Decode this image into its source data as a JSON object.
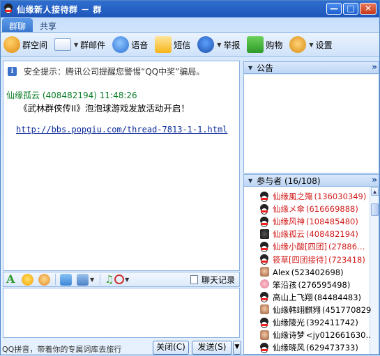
{
  "window": {
    "title": "仙缘新人接待群 － 群"
  },
  "tabs": [
    {
      "label": "群聊"
    },
    {
      "label": "共享"
    }
  ],
  "toolbar": {
    "items": [
      {
        "label": "群空间",
        "icon": "group-space-icon"
      },
      {
        "label": "群邮件",
        "icon": "mail-icon"
      },
      {
        "label": "语音",
        "icon": "voice-icon"
      },
      {
        "label": "短信",
        "icon": "sms-icon"
      },
      {
        "label": "举报",
        "icon": "report-icon"
      },
      {
        "label": "购物",
        "icon": "shopping-icon"
      },
      {
        "label": "设置",
        "icon": "settings-icon"
      }
    ]
  },
  "chat": {
    "notice": "安全提示：腾讯公司提醒您警惕“QQ中奖”骗局。",
    "message": {
      "sender": "仙缘孤云",
      "sender_id": "(408482194)",
      "time": "11:48:26",
      "text": "《武林群侠传II》泡泡球游戏发放活动开启！",
      "link": "http://bbs.popgiu.com/thread-7813-1-1.html"
    }
  },
  "format_bar": {
    "history_label": "聊天记录"
  },
  "bottom": {
    "ime_tip": "QQ拼音，带着你的专属词库去旅行",
    "close_label": "关闭(C)",
    "send_label": "发送(S)"
  },
  "board": {
    "title": "公告"
  },
  "members": {
    "title": "参与者 (16/108)",
    "list": [
      {
        "name": "仙缘風之殤",
        "qq": "(136030349)",
        "admin": true,
        "avatar": "penguin"
      },
      {
        "name": "仙缘メ傘",
        "qq": "(616669888)",
        "admin": true,
        "avatar": "penguin"
      },
      {
        "name": "仙缘风神",
        "qq": "(108485480)",
        "admin": true,
        "avatar": "penguin"
      },
      {
        "name": "仙缘孤云",
        "qq": "(408482194)",
        "admin": true,
        "avatar": "dark"
      },
      {
        "name": "仙缘小酸[四团]",
        "qq": "(27886…",
        "admin": true,
        "avatar": "penguin"
      },
      {
        "name": "筱草[四团接待]",
        "qq": "(723418)",
        "admin": true,
        "avatar": "penguin"
      },
      {
        "name": "Alex",
        "qq": "(523402698)",
        "admin": false,
        "avatar": "face"
      },
      {
        "name": "笨沿孩",
        "qq": "(276595498)",
        "admin": false,
        "avatar": "pig"
      },
      {
        "name": "高山上飞翔",
        "qq": "(84484483)",
        "admin": false,
        "avatar": "penguin"
      },
      {
        "name": "仙缘韩翊麒翙",
        "qq": "(451770829)",
        "admin": false,
        "avatar": "face"
      },
      {
        "name": "仙缘陵光",
        "qq": "(392411742)",
        "admin": false,
        "avatar": "penguin"
      },
      {
        "name": "仙缘诗梦",
        "qq": "<jy012661630…",
        "admin": false,
        "avatar": "face"
      },
      {
        "name": "仙缘晓风",
        "qq": "(629473733)",
        "admin": false,
        "avatar": "penguin"
      }
    ]
  },
  "colors": {
    "titlebar": "#1d55b8",
    "admin_name": "#d11c1c",
    "sender": "#0a7d27",
    "link": "#0b2a9a"
  }
}
